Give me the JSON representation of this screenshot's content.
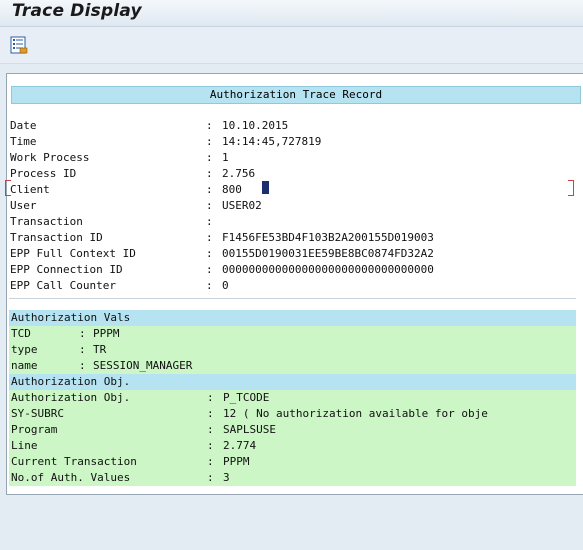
{
  "window": {
    "title": "Trace Display"
  },
  "toolbar": {
    "icon": "list-detail-icon"
  },
  "record": {
    "header": "Authorization Trace Record",
    "fields": [
      {
        "label": "Date",
        "value": "10.10.2015"
      },
      {
        "label": "Time",
        "value": "14:14:45,727819"
      },
      {
        "label": "Work Process",
        "value": "1"
      },
      {
        "label": "Process ID",
        "value": "2.756"
      },
      {
        "label": "Client",
        "value": "800"
      },
      {
        "label": "User",
        "value": "USER02"
      },
      {
        "label": "Transaction",
        "value": ""
      },
      {
        "label": "Transaction ID",
        "value": "F1456FE53BD4F103B2A200155D019003"
      },
      {
        "label": "EPP Full Context ID",
        "value": "00155D0190031EE59BE8BC0874FD32A2"
      },
      {
        "label": "EPP Connection ID",
        "value": "00000000000000000000000000000000"
      },
      {
        "label": "EPP Call Counter",
        "value": "0"
      }
    ],
    "separator": ":"
  },
  "auth_vals": {
    "header": "Authorization Vals",
    "fields": [
      {
        "label": "TCD",
        "value": "PPPM"
      },
      {
        "label": "type",
        "value": "TR"
      },
      {
        "label": "name",
        "value": "SESSION_MANAGER"
      }
    ]
  },
  "auth_obj": {
    "header": "Authorization Obj.",
    "fields": [
      {
        "label": "Authorization Obj.",
        "value": "P_TCODE"
      },
      {
        "label": "SY-SUBRC",
        "value": "12 ( No authorization available for obje"
      },
      {
        "label": "Program",
        "value": "SAPLSUSE"
      },
      {
        "label": "Line",
        "value": "2.774"
      },
      {
        "label": "Current Transaction",
        "value": "PPPM"
      },
      {
        "label": "No.of Auth. Values",
        "value": "3"
      }
    ]
  },
  "colors": {
    "header_blue": "#b6e3f1",
    "row_green": "#cdf6c7",
    "cursor": "#1d2f6e"
  }
}
